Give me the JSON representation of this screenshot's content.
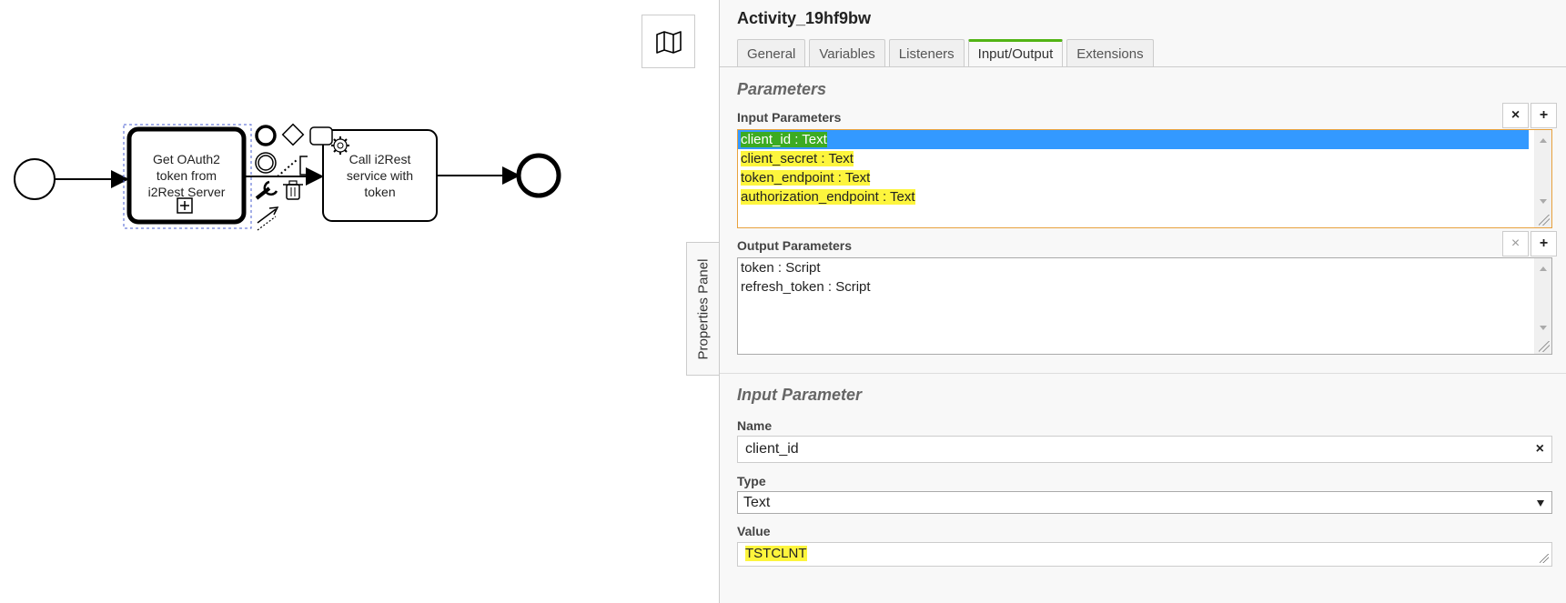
{
  "diagram": {
    "task1_lines": [
      "Get OAuth2",
      "token from",
      "i2Rest Server"
    ],
    "task2_lines": [
      "Call i2Rest",
      "service with",
      "token"
    ]
  },
  "panel": {
    "title": "Activity_19hf9bw",
    "tabs": [
      {
        "label": "General"
      },
      {
        "label": "Variables"
      },
      {
        "label": "Listeners"
      },
      {
        "label": "Input/Output",
        "active": true
      },
      {
        "label": "Extensions"
      }
    ],
    "toggle_label": "Properties Panel",
    "parameters_group": "Parameters",
    "input_parameters_label": "Input Parameters",
    "input_parameters": [
      {
        "label": "client_id : Text",
        "selected": true
      },
      {
        "label": "client_secret : Text"
      },
      {
        "label": "token_endpoint : Text"
      },
      {
        "label": "authorization_endpoint : Text"
      }
    ],
    "output_parameters_label": "Output Parameters",
    "output_parameters": [
      {
        "label": "token : Script"
      },
      {
        "label": "refresh_token : Script"
      }
    ],
    "remove_symbol": "×",
    "add_symbol": "+",
    "input_parameter_group": "Input Parameter",
    "name_label": "Name",
    "name_value": "client_id",
    "type_label": "Type",
    "type_value": "Text",
    "value_label": "Value",
    "value_value": "TSTCLNT"
  },
  "colors": {
    "accent_tab": "#52b415",
    "selection": "#3399ff",
    "focus_border": "#e8a13d",
    "highlight_yellow": "#fdf53d",
    "highlight_green": "#3cab22"
  }
}
